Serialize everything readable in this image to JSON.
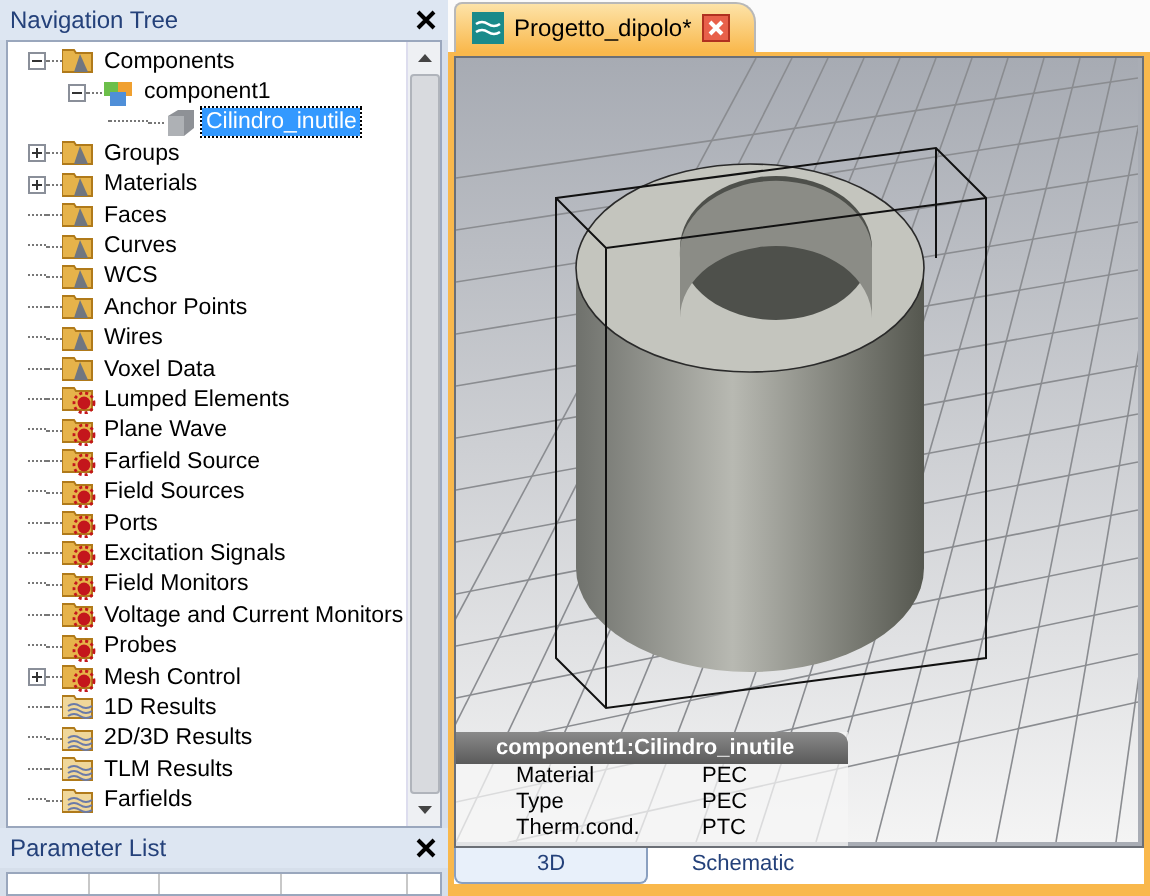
{
  "navigation_tree": {
    "title": "Navigation Tree",
    "items": [
      {
        "label": "Components",
        "kind": "folder-cone",
        "expanded": true,
        "selected": false,
        "children": [
          {
            "label": "component1",
            "kind": "component",
            "expanded": true,
            "selected": false,
            "children": [
              {
                "label": "Cilindro_inutile",
                "kind": "solid",
                "selected": true
              }
            ]
          }
        ]
      },
      {
        "label": "Groups",
        "kind": "folder-cone",
        "expanded": false,
        "selected": false
      },
      {
        "label": "Materials",
        "kind": "folder-cone",
        "expanded": false,
        "selected": false
      },
      {
        "label": "Faces",
        "kind": "folder-cone",
        "selected": false
      },
      {
        "label": "Curves",
        "kind": "folder-cone",
        "selected": false
      },
      {
        "label": "WCS",
        "kind": "folder-cone",
        "selected": false
      },
      {
        "label": "Anchor Points",
        "kind": "folder-cone",
        "selected": false
      },
      {
        "label": "Wires",
        "kind": "folder-cone",
        "selected": false
      },
      {
        "label": "Voxel Data",
        "kind": "folder-cone",
        "selected": false
      },
      {
        "label": "Lumped Elements",
        "kind": "folder-star",
        "selected": false
      },
      {
        "label": "Plane Wave",
        "kind": "folder-star",
        "selected": false
      },
      {
        "label": "Farfield Source",
        "kind": "folder-star",
        "selected": false
      },
      {
        "label": "Field Sources",
        "kind": "folder-star",
        "selected": false
      },
      {
        "label": "Ports",
        "kind": "folder-star",
        "selected": false
      },
      {
        "label": "Excitation Signals",
        "kind": "folder-star",
        "selected": false
      },
      {
        "label": "Field Monitors",
        "kind": "folder-star",
        "selected": false
      },
      {
        "label": "Voltage and Current Monitors",
        "kind": "folder-star",
        "selected": false
      },
      {
        "label": "Probes",
        "kind": "folder-star",
        "selected": false
      },
      {
        "label": "Mesh Control",
        "kind": "folder-star",
        "expanded": false,
        "selected": false
      },
      {
        "label": "1D Results",
        "kind": "folder-results",
        "selected": false
      },
      {
        "label": "2D/3D Results",
        "kind": "folder-results",
        "selected": false
      },
      {
        "label": "TLM Results",
        "kind": "folder-results",
        "selected": false
      },
      {
        "label": "Farfields",
        "kind": "folder-results",
        "selected": false
      }
    ]
  },
  "parameter_list": {
    "title": "Parameter List"
  },
  "document_tabs": [
    {
      "label": "Progetto_dipolo*",
      "selected": true
    }
  ],
  "info_overlay": {
    "title": "component1:Cilindro_inutile",
    "rows": [
      {
        "label": "Material",
        "value": "PEC"
      },
      {
        "label": "Type",
        "value": "PEC"
      },
      {
        "label": "Therm.cond.",
        "value": "PTC"
      }
    ]
  },
  "view_tabs": [
    {
      "label": "3D",
      "selected": true
    },
    {
      "label": "Schematic",
      "selected": false
    }
  ]
}
